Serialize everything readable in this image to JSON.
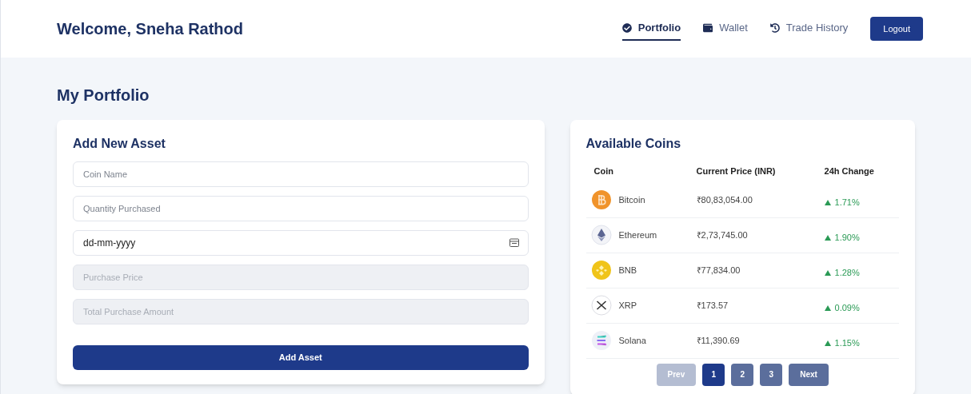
{
  "header": {
    "greeting": "Welcome, Sneha Rathod",
    "nav": [
      {
        "label": "Portfolio",
        "kind": "check",
        "selected": true
      },
      {
        "label": "Wallet",
        "kind": "wallet",
        "selected": false
      },
      {
        "label": "Trade History",
        "kind": "history",
        "selected": false
      }
    ],
    "logout": "Logout"
  },
  "page_title": "My Portfolio",
  "add_asset": {
    "title": "Add New Asset",
    "fields": [
      {
        "placeholder": "Coin Name",
        "disabled": false
      },
      {
        "placeholder": "Quantity Purchased",
        "disabled": false
      },
      {
        "value": "dd-mm-yyyy",
        "kind": "date",
        "disabled": false
      },
      {
        "placeholder": "Purchase Price",
        "disabled": true
      },
      {
        "placeholder": "Total Purchase Amount",
        "disabled": true
      }
    ],
    "button": "Add Asset"
  },
  "coins": {
    "title": "Available Coins",
    "columns": [
      "Coin",
      "Current Price (INR)",
      "24h Change"
    ],
    "rows": [
      {
        "kind": "bitcoin",
        "name": "Bitcoin",
        "price": "₹80,83,054.00",
        "change": "1.71%"
      },
      {
        "kind": "ethereum",
        "name": "Ethereum",
        "price": "₹2,73,745.00",
        "change": "1.90%"
      },
      {
        "kind": "bnb",
        "name": "BNB",
        "price": "₹77,834.00",
        "change": "1.28%"
      },
      {
        "kind": "xrp",
        "name": "XRP",
        "price": "₹173.57",
        "change": "0.09%"
      },
      {
        "kind": "solana",
        "name": "Solana",
        "price": "₹11,390.69",
        "change": "1.15%"
      }
    ],
    "pagination": [
      {
        "label": "Prev",
        "disabled": true,
        "selected": false
      },
      {
        "label": "1",
        "disabled": false,
        "selected": true
      },
      {
        "label": "2",
        "disabled": false,
        "selected": false
      },
      {
        "label": "3",
        "disabled": false,
        "selected": false
      },
      {
        "label": "Next",
        "disabled": false,
        "selected": false
      }
    ]
  }
}
